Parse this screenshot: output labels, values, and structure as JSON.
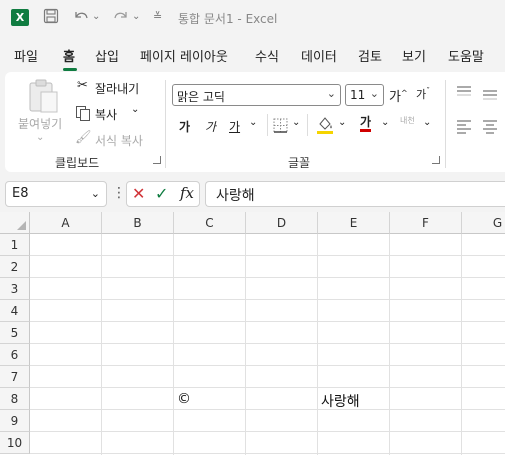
{
  "titlebar": {
    "logo_letter": "X",
    "doc_title": "통합 문서1 - Excel"
  },
  "menu": {
    "tabs": [
      "파일",
      "홈",
      "삽입",
      "페이지 레이아웃",
      "수식",
      "데이터",
      "검토",
      "보기",
      "도움말"
    ],
    "active": "홈"
  },
  "ribbon": {
    "clipboard": {
      "paste": "붙여넣기",
      "cut": "잘라내기",
      "copy": "복사",
      "format_painter": "서식 복사",
      "label": "클립보드"
    },
    "font": {
      "family": "맑은 고딕",
      "size": "11",
      "grow": "가",
      "shrink": "가",
      "bold": "가",
      "italic": "가",
      "underline": "가",
      "font_color": "가",
      "phonetic": "내천",
      "label": "글꼴"
    },
    "colors": {
      "fill_swatch": "#f5d400",
      "font_swatch": "#d00000"
    }
  },
  "formula_bar": {
    "name_box": "E8",
    "more": "⋮",
    "cancel": "✕",
    "enter": "✓",
    "fx": "fx",
    "value": "사랑해"
  },
  "grid": {
    "columns": [
      "A",
      "B",
      "C",
      "D",
      "E",
      "F",
      "G"
    ],
    "rows": [
      "1",
      "2",
      "3",
      "4",
      "5",
      "6",
      "7",
      "8",
      "9",
      "10"
    ],
    "cells": {
      "C8": "©",
      "E8": "사랑해"
    }
  }
}
